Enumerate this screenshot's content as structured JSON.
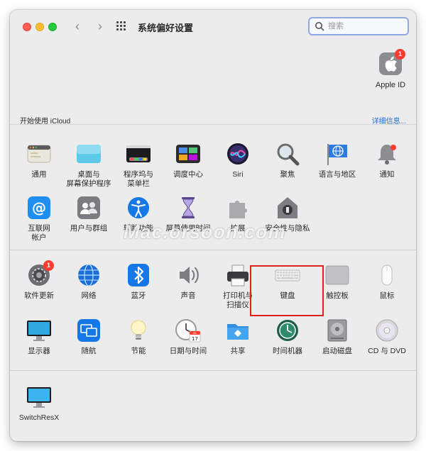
{
  "window": {
    "title": "系统偏好设置"
  },
  "search": {
    "placeholder": "搜索"
  },
  "account": {
    "apple_id_label": "Apple ID",
    "apple_id_badge": "1"
  },
  "icloud": {
    "prompt": "开始使用 iCloud",
    "details_link": "详细信息..."
  },
  "row1": [
    {
      "name": "通用",
      "icon": "general-icon"
    },
    {
      "name": "桌面与\n屏幕保护程序",
      "icon": "desktop-screensaver-icon"
    },
    {
      "name": "程序坞与\n菜单栏",
      "icon": "dock-menubar-icon"
    },
    {
      "name": "调度中心",
      "icon": "mission-control-icon"
    },
    {
      "name": "Siri",
      "icon": "siri-icon"
    },
    {
      "name": "聚焦",
      "icon": "spotlight-icon"
    },
    {
      "name": "语言与地区",
      "icon": "language-region-icon"
    },
    {
      "name": "通知",
      "icon": "notifications-icon"
    }
  ],
  "row2": [
    {
      "name": "互联网\n帐户",
      "icon": "internet-accounts-icon"
    },
    {
      "name": "用户与群组",
      "icon": "users-groups-icon"
    },
    {
      "name": "辅助功能",
      "icon": "accessibility-icon"
    },
    {
      "name": "屏幕使用时间",
      "icon": "screen-time-icon"
    },
    {
      "name": "扩展",
      "icon": "extensions-icon"
    },
    {
      "name": "安全性与隐私",
      "icon": "security-privacy-icon"
    }
  ],
  "row3": [
    {
      "name": "软件更新",
      "icon": "software-update-icon",
      "badge": "1"
    },
    {
      "name": "网络",
      "icon": "network-icon"
    },
    {
      "name": "蓝牙",
      "icon": "bluetooth-icon"
    },
    {
      "name": "声音",
      "icon": "sound-icon"
    },
    {
      "name": "打印机与\n扫描仪",
      "icon": "printers-scanners-icon"
    },
    {
      "name": "键盘",
      "icon": "keyboard-icon"
    },
    {
      "name": "触控板",
      "icon": "trackpad-icon"
    },
    {
      "name": "鼠标",
      "icon": "mouse-icon"
    }
  ],
  "row4": [
    {
      "name": "显示器",
      "icon": "displays-icon"
    },
    {
      "name": "随航",
      "icon": "sidecar-icon"
    },
    {
      "name": "节能",
      "icon": "energy-saver-icon"
    },
    {
      "name": "日期与时间",
      "icon": "date-time-icon"
    },
    {
      "name": "共享",
      "icon": "sharing-icon"
    },
    {
      "name": "时间机器",
      "icon": "time-machine-icon"
    },
    {
      "name": "启动磁盘",
      "icon": "startup-disk-icon"
    },
    {
      "name": "CD 与 DVD",
      "icon": "cd-dvd-icon"
    }
  ],
  "row5": [
    {
      "name": "SwitchResX",
      "icon": "switchresx-icon"
    }
  ],
  "calendar": {
    "month": "JUL",
    "day": "17"
  },
  "watermark": "Mac.orsoon.com",
  "colors": {
    "accent": "#1f6fd1",
    "highlight": "#e0201c",
    "badge": "#ff3b30"
  }
}
